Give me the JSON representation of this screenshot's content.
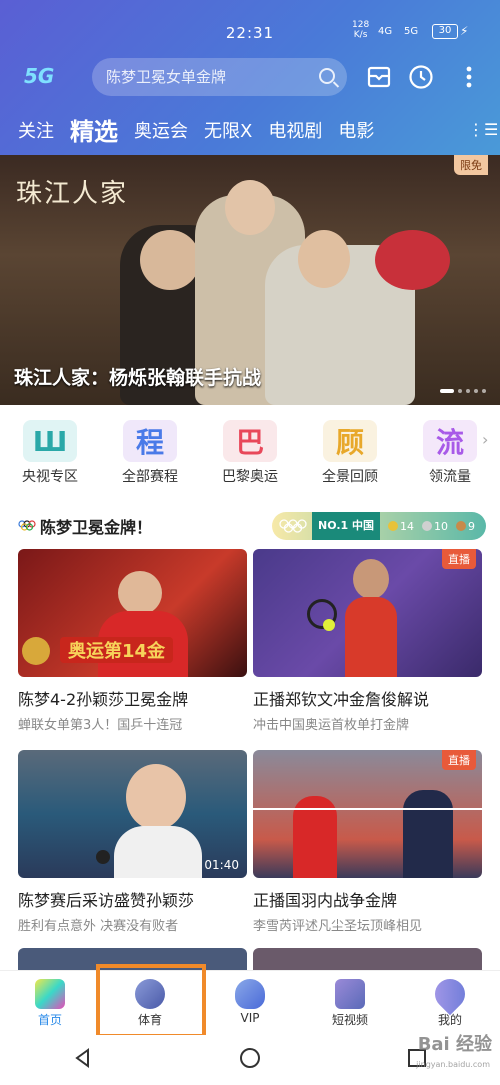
{
  "status": {
    "time": "22:31",
    "net_speed": "128",
    "net_unit": "K/s",
    "sig1": "4G",
    "sig2": "5G",
    "battery": "30"
  },
  "header": {
    "logo": "5G",
    "search_placeholder": "陈梦卫冕女单金牌"
  },
  "tabs": [
    {
      "label": "关注"
    },
    {
      "label": "精选"
    },
    {
      "label": "奥运会"
    },
    {
      "label": "无限X"
    },
    {
      "label": "电视剧"
    },
    {
      "label": "电影"
    }
  ],
  "banner": {
    "art_title": "珠江人家",
    "badge": "限免",
    "caption": "珠江人家：杨烁张翰联手抗战"
  },
  "shortcuts": [
    {
      "label": "央视专区",
      "icon": "cctv-icon",
      "color": "#2aa8a8"
    },
    {
      "label": "全部赛程",
      "icon": "schedule-icon",
      "color": "#4a7ae8"
    },
    {
      "label": "巴黎奥运",
      "icon": "paris-icon",
      "color": "#e8485a"
    },
    {
      "label": "全景回顾",
      "icon": "review-icon",
      "color": "#e8a82a"
    },
    {
      "label": "领流量",
      "icon": "data-icon",
      "color": "#a85ae8"
    }
  ],
  "section": {
    "title": "陈梦卫冕金牌！",
    "rank_label": "NO.1 中国",
    "gold": "14",
    "silver": "10",
    "bronze": "9"
  },
  "cards": [
    {
      "title": "陈梦4-2孙颖莎卫冕金牌",
      "subtitle": "蝉联女单第3人！国乒十连冠",
      "stamp": "奥运第14金",
      "live": "",
      "duration": ""
    },
    {
      "title": "正播郑钦文冲金詹俊解说",
      "subtitle": "冲击中国奥运首枚单打金牌",
      "stamp": "",
      "live": "直播",
      "duration": ""
    },
    {
      "title": "陈梦赛后采访盛赞孙颖莎",
      "subtitle": "胜利有点意外 决赛没有败者",
      "stamp": "",
      "live": "",
      "duration": "01:40"
    },
    {
      "title": "正播国羽内战争金牌",
      "subtitle": "李雪芮评述凡尘圣坛顶峰相见",
      "stamp": "",
      "live": "直播",
      "duration": ""
    }
  ],
  "nav": [
    {
      "label": "首页",
      "icon": "home-icon"
    },
    {
      "label": "体育",
      "icon": "sports-icon"
    },
    {
      "label": "VIP",
      "icon": "vip-icon"
    },
    {
      "label": "短视频",
      "icon": "short-video-icon"
    },
    {
      "label": "我的",
      "icon": "profile-icon"
    }
  ],
  "watermark": {
    "main": "Bai 经验",
    "sub": "jingyan.baidu.com"
  },
  "colors": {
    "accent": "#4a7ad8",
    "highlight": "#f08a2a",
    "live": "#e85a3a"
  }
}
